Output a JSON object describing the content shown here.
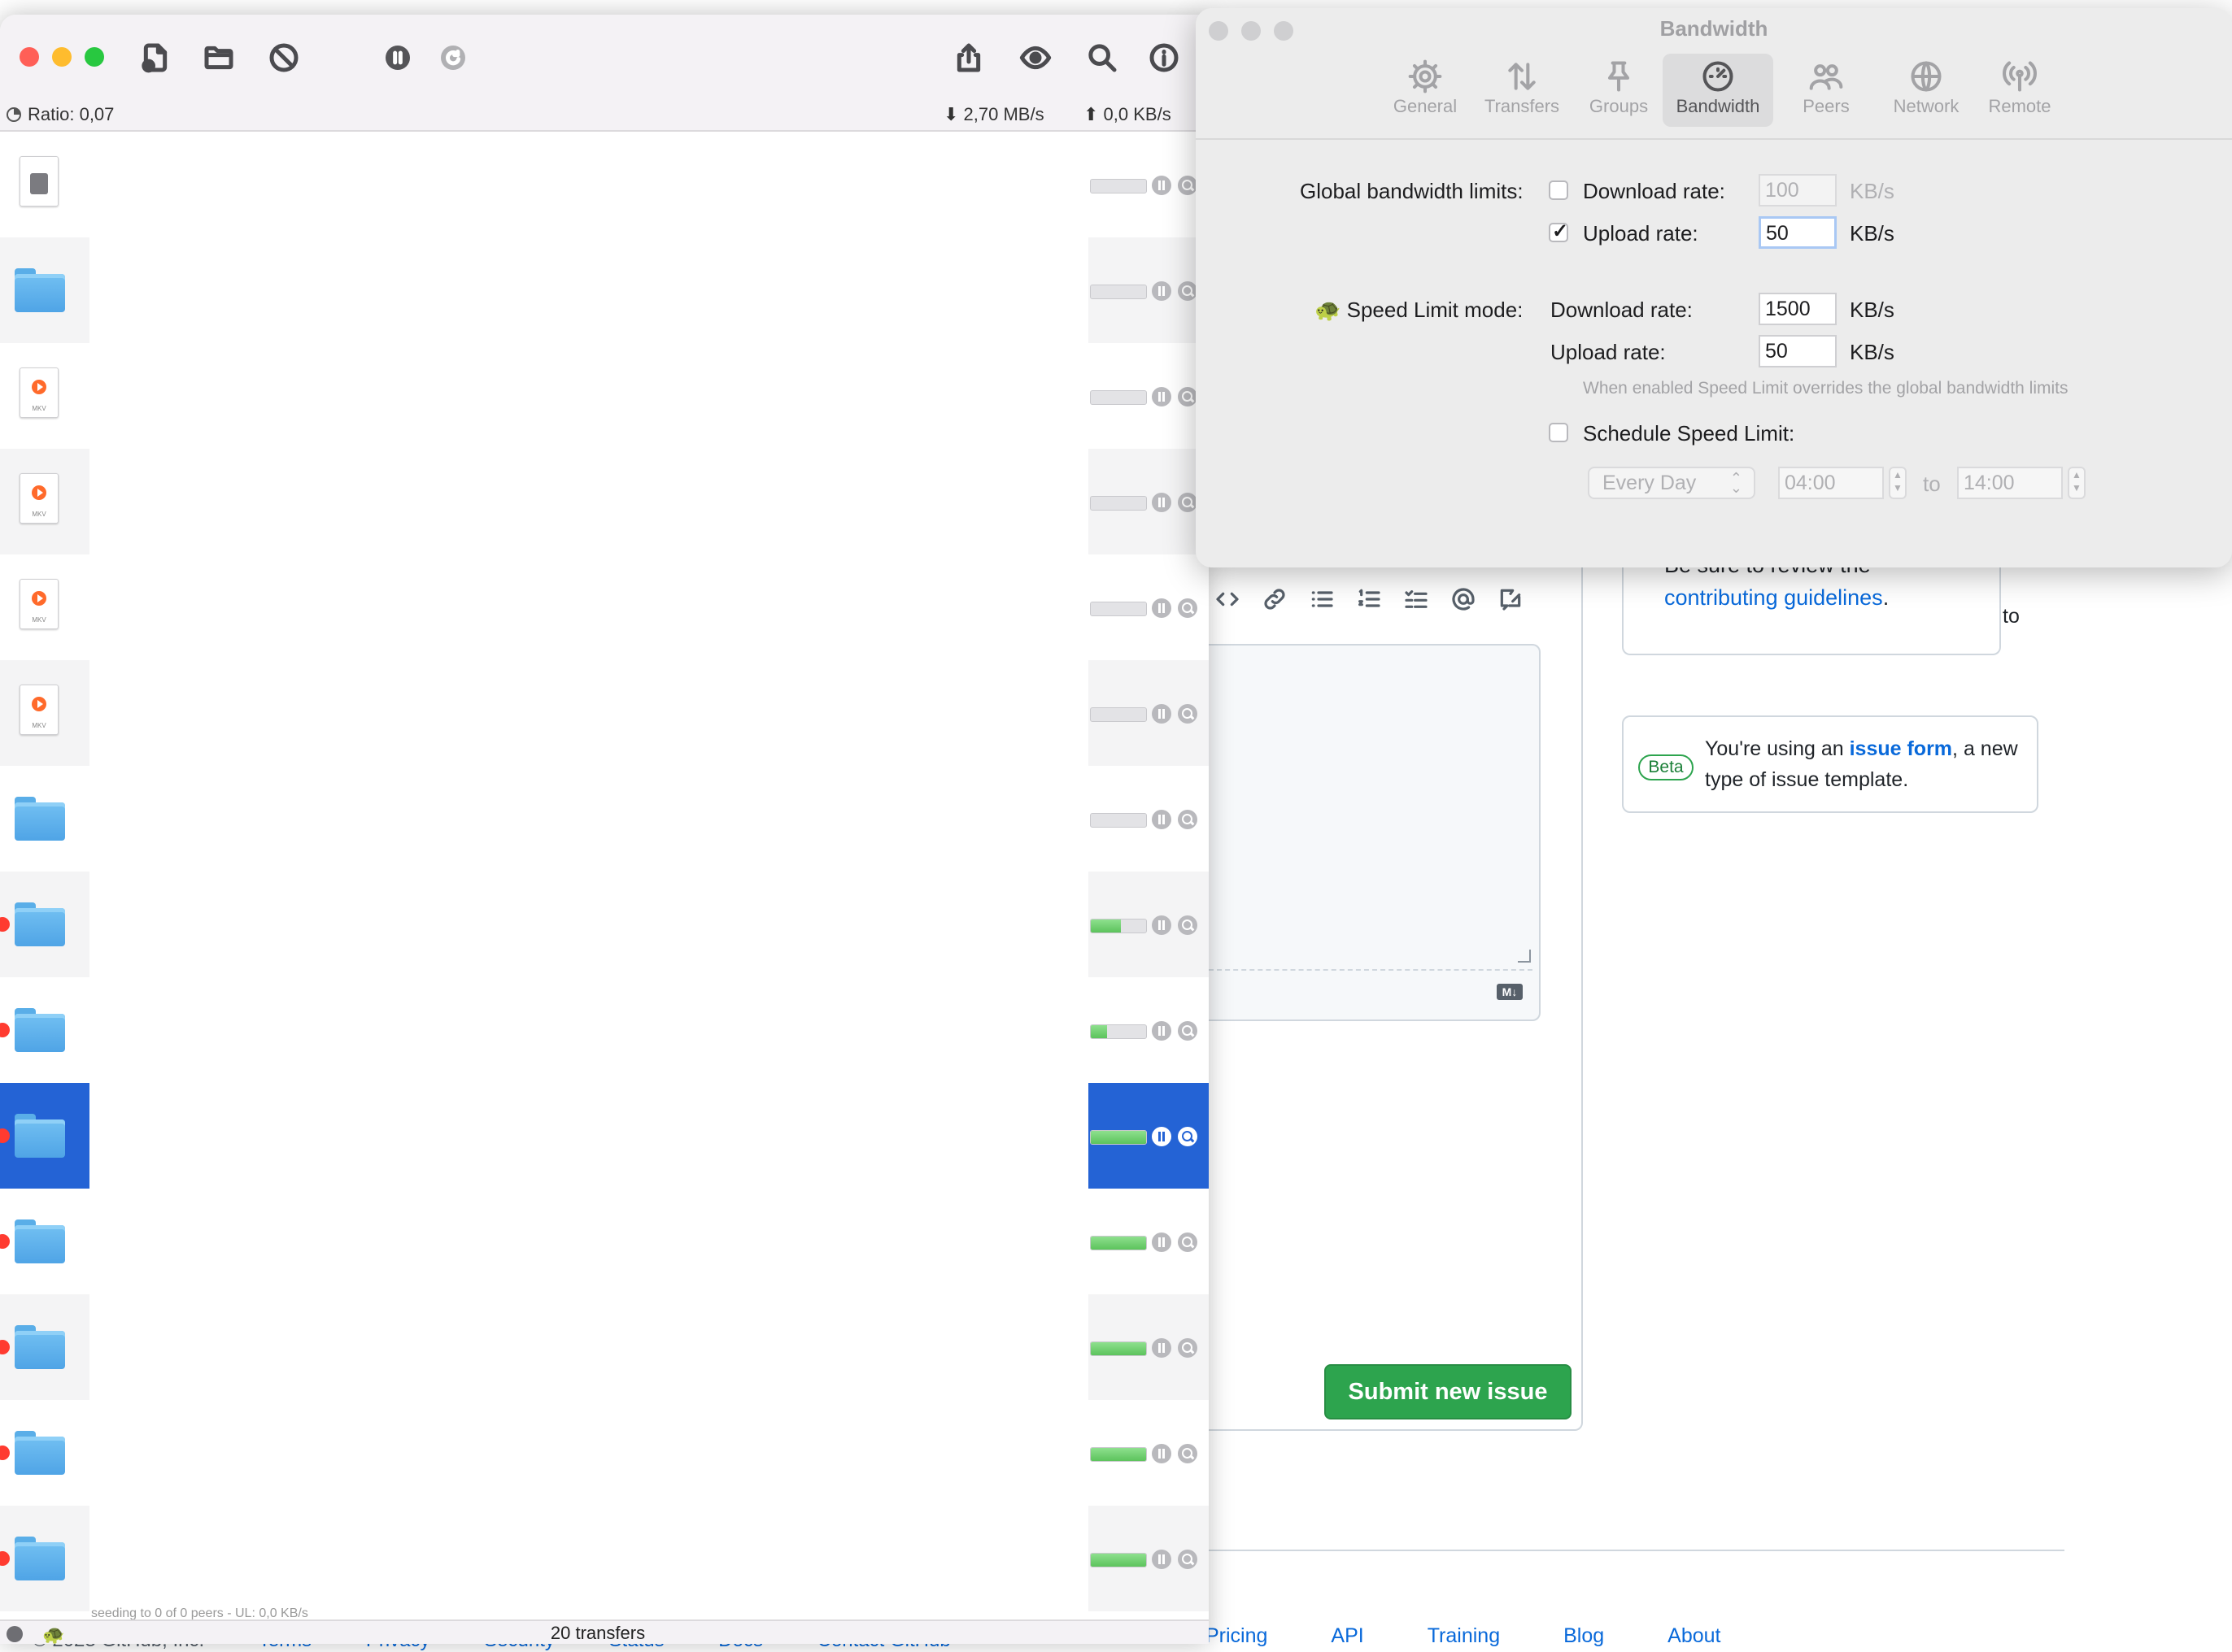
{
  "main": {
    "ratio": "Ratio: 0,07",
    "download_speed": "2,70 MB/s",
    "upload_speed": "0,0 KB/s",
    "transfer_count": "20 transfers",
    "faint_text": "seeding to 0 of 0 peers - UL: 0,0 KB/s",
    "rows": [
      {
        "kind": "disk",
        "progress": 0,
        "red": false
      },
      {
        "kind": "folder",
        "progress": 0,
        "red": false
      },
      {
        "kind": "mkv",
        "progress": 0,
        "red": false
      },
      {
        "kind": "mkv",
        "progress": 0,
        "red": false
      },
      {
        "kind": "mkv",
        "progress": 0,
        "red": false
      },
      {
        "kind": "mkv",
        "progress": 0,
        "red": false
      },
      {
        "kind": "folder",
        "progress": 0,
        "red": false
      },
      {
        "kind": "folder",
        "progress": 0.55,
        "red": true
      },
      {
        "kind": "folder",
        "progress": 0.3,
        "red": true
      },
      {
        "kind": "folder",
        "progress": 1.0,
        "red": true,
        "selected": true
      },
      {
        "kind": "folder",
        "progress": 1.0,
        "red": true
      },
      {
        "kind": "folder",
        "progress": 1.0,
        "red": true
      },
      {
        "kind": "folder",
        "progress": 1.0,
        "red": true
      },
      {
        "kind": "folder",
        "progress": 1.0,
        "red": true
      }
    ],
    "mkv_ext": "MKV"
  },
  "prefs": {
    "title": "Bandwidth",
    "tabs": [
      "General",
      "Transfers",
      "Groups",
      "Bandwidth",
      "Peers",
      "Network",
      "Remote"
    ],
    "active_tab": "Bandwidth",
    "global_label": "Global bandwidth limits:",
    "download_rate_label": "Download rate:",
    "upload_rate_label": "Upload rate:",
    "global_download_value": "100",
    "global_upload_value": "50",
    "unit": "KB/s",
    "speed_limit_label": "Speed Limit mode:",
    "speed_download_value": "1500",
    "speed_upload_value": "50",
    "hint": "When enabled Speed Limit overrides the global bandwidth limits",
    "schedule_label": "Schedule Speed Limit:",
    "schedule_day": "Every Day",
    "schedule_from": "04:00",
    "schedule_to_label": "to",
    "schedule_to": "14:00"
  },
  "github": {
    "guidelines_line1": "Be sure to review the",
    "guidelines_link": "contributing guidelines",
    "guidelines_period": ".",
    "side_to": "to",
    "beta_label": "Beta",
    "beta_text_pre": "You're using an ",
    "beta_link": "issue form",
    "beta_text_post": ", a new type of issue template.",
    "md_badge": "M↓",
    "submit_label": "Submit new issue",
    "footer_left": "© 2023 GitHub, Inc.",
    "footer_left_links": [
      "Terms",
      "Privacy",
      "Security",
      "Status",
      "Docs",
      "Contact GitHub"
    ],
    "footer_links": [
      "Pricing",
      "API",
      "Training",
      "Blog",
      "About"
    ]
  }
}
